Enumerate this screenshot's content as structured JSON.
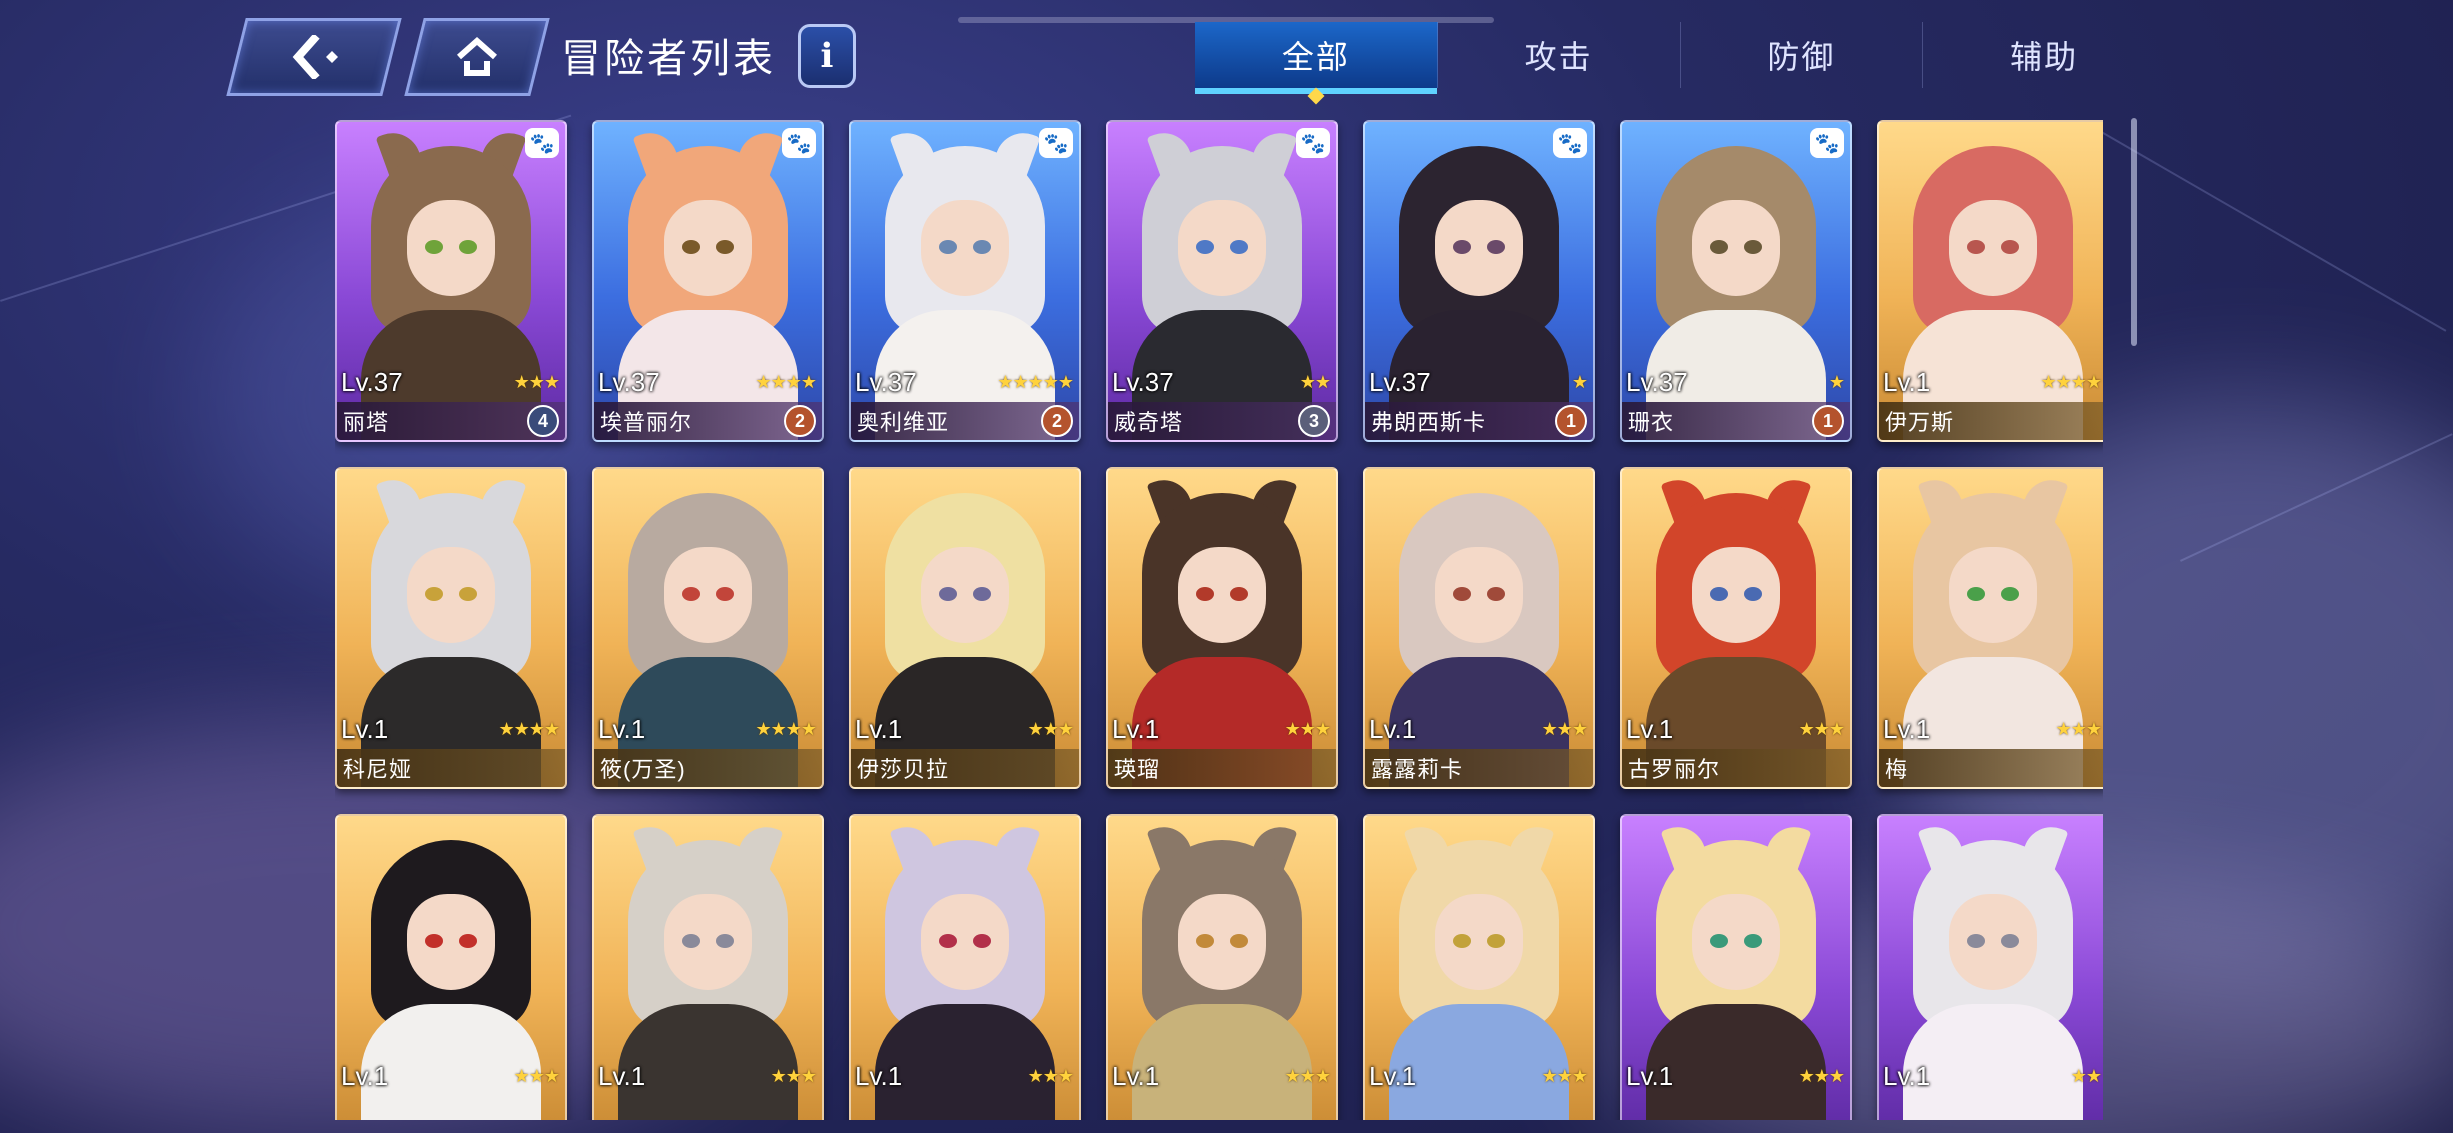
{
  "header": {
    "title": "冒险者列表",
    "info_label": "i"
  },
  "tabs": [
    {
      "label": "全部",
      "active": true
    },
    {
      "label": "攻击",
      "active": false
    },
    {
      "label": "防御",
      "active": false
    },
    {
      "label": "辅助",
      "active": false
    }
  ],
  "cards": [
    {
      "name": "丽塔",
      "level": "Lv.37",
      "stars": "★★★",
      "badge": "4",
      "rarity": "purple",
      "paw": true,
      "hair": "#8a6a4e",
      "eye": "#6fa33a",
      "body": "#4d3a2c",
      "ears": true,
      "badge_color": "#3a4b7a"
    },
    {
      "name": "埃普丽尔",
      "level": "Lv.37",
      "stars": "★★★★",
      "badge": "2",
      "rarity": "blue",
      "paw": true,
      "hair": "#f1a77a",
      "eye": "#7a5a2a",
      "body": "#f3e6e8",
      "ears": true,
      "badge_color": "#b4532d"
    },
    {
      "name": "奥利维亚",
      "level": "Lv.37",
      "stars": "★★★★★",
      "badge": "2",
      "rarity": "blue",
      "paw": true,
      "hair": "#e8e8ee",
      "eye": "#6a88b2",
      "body": "#f4f1ee",
      "ears": true,
      "badge_color": "#b4532d"
    },
    {
      "name": "威奇塔",
      "level": "Lv.37",
      "stars": "★★",
      "badge": "3",
      "rarity": "purple",
      "paw": true,
      "hair": "#cfcfd6",
      "eye": "#4f79c6",
      "body": "#2a2a30",
      "ears": true,
      "badge_color": "#5b5f7a"
    },
    {
      "name": "弗朗西斯卡",
      "level": "Lv.37",
      "stars": "★",
      "badge": "1",
      "rarity": "blue",
      "paw": true,
      "hair": "#2c2430",
      "eye": "#6a4a6a",
      "body": "#2a2230",
      "ears": false,
      "badge_color": "#b4532d"
    },
    {
      "name": "珊衣",
      "level": "Lv.37",
      "stars": "★",
      "badge": "1",
      "rarity": "blue",
      "paw": true,
      "hair": "#a58a6a",
      "eye": "#6a5a3a",
      "body": "#f0ece6",
      "ears": false,
      "badge_color": "#b4532d"
    },
    {
      "name": "伊万斯",
      "level": "Lv.1",
      "stars": "★★★★",
      "badge": "",
      "rarity": "gold",
      "paw": false,
      "hair": "#d86a62",
      "eye": "#b8564f",
      "body": "#f6e3d6",
      "ears": false,
      "badge_color": ""
    },
    {
      "name": "科尼娅",
      "level": "Lv.1",
      "stars": "★★★★",
      "badge": "",
      "rarity": "gold",
      "paw": false,
      "hair": "#d8d8dc",
      "eye": "#c8a23a",
      "body": "#2c2a2a",
      "ears": true,
      "badge_color": ""
    },
    {
      "name": "筱(万圣)",
      "level": "Lv.1",
      "stars": "★★★★",
      "badge": "",
      "rarity": "gold",
      "paw": false,
      "hair": "#b8aaa0",
      "eye": "#c2453a",
      "body": "#2e4a5a",
      "ears": false,
      "badge_color": ""
    },
    {
      "name": "伊莎贝拉",
      "level": "Lv.1",
      "stars": "★★★",
      "badge": "",
      "rarity": "gold",
      "paw": false,
      "hair": "#efe0a2",
      "eye": "#6e6a9a",
      "body": "#2a2626",
      "ears": false,
      "badge_color": ""
    },
    {
      "name": "瑛瑠",
      "level": "Lv.1",
      "stars": "★★★",
      "badge": "",
      "rarity": "gold",
      "paw": false,
      "hair": "#4a3428",
      "eye": "#b23a2a",
      "body": "#b42a28",
      "ears": true,
      "badge_color": ""
    },
    {
      "name": "露露莉卡",
      "level": "Lv.1",
      "stars": "★★★",
      "badge": "",
      "rarity": "gold",
      "paw": false,
      "hair": "#d9c8c0",
      "eye": "#a04a3a",
      "body": "#3a3260",
      "ears": false,
      "badge_color": ""
    },
    {
      "name": "古罗丽尔",
      "level": "Lv.1",
      "stars": "★★★",
      "badge": "",
      "rarity": "gold",
      "paw": false,
      "hair": "#d2452a",
      "eye": "#4a6ab2",
      "body": "#6a4a2a",
      "ears": true,
      "badge_color": ""
    },
    {
      "name": "梅",
      "level": "Lv.1",
      "stars": "★★★",
      "badge": "",
      "rarity": "gold",
      "paw": false,
      "hair": "#e8c6a2",
      "eye": "#4aa04a",
      "body": "#f2e6e0",
      "ears": true,
      "badge_color": ""
    },
    {
      "name": "",
      "level": "Lv.1",
      "stars": "★★★",
      "badge": "",
      "rarity": "gold",
      "paw": false,
      "hair": "#1e1a1e",
      "eye": "#c2302a",
      "body": "#f2f0ee",
      "ears": false,
      "badge_color": ""
    },
    {
      "name": "",
      "level": "Lv.1",
      "stars": "★★★",
      "badge": "",
      "rarity": "gold",
      "paw": false,
      "hair": "#d6d0c8",
      "eye": "#8a8a9a",
      "body": "#3a3430",
      "ears": true,
      "badge_color": ""
    },
    {
      "name": "",
      "level": "Lv.1",
      "stars": "★★★",
      "badge": "",
      "rarity": "gold",
      "paw": false,
      "hair": "#cfc6e0",
      "eye": "#b2304a",
      "body": "#2a2230",
      "ears": true,
      "badge_color": ""
    },
    {
      "name": "",
      "level": "Lv.1",
      "stars": "★★★",
      "badge": "",
      "rarity": "gold",
      "paw": false,
      "hair": "#8a7868",
      "eye": "#c28a3a",
      "body": "#c8b27a",
      "ears": true,
      "badge_color": ""
    },
    {
      "name": "",
      "level": "Lv.1",
      "stars": "★★★",
      "badge": "",
      "rarity": "gold",
      "paw": false,
      "hair": "#f0d8a8",
      "eye": "#c2a23a",
      "body": "#8aa8e0",
      "ears": true,
      "badge_color": ""
    },
    {
      "name": "",
      "level": "Lv.1",
      "stars": "★★★",
      "badge": "",
      "rarity": "purple",
      "paw": false,
      "hair": "#f3dba0",
      "eye": "#3a9a7a",
      "body": "#3a2a2a",
      "ears": true,
      "badge_color": ""
    },
    {
      "name": "",
      "level": "Lv.1",
      "stars": "★★",
      "badge": "",
      "rarity": "purple",
      "paw": false,
      "hair": "#e8e6ea",
      "eye": "#8a8a9a",
      "body": "#f4eef4",
      "ears": true,
      "badge_color": ""
    }
  ]
}
